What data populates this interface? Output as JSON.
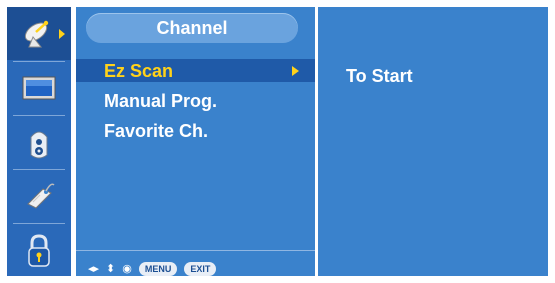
{
  "sidebar": {
    "icons": [
      {
        "name": "satellite-dish-icon",
        "selected": true
      },
      {
        "name": "picture-icon",
        "selected": false
      },
      {
        "name": "audio-info-icon",
        "selected": false
      },
      {
        "name": "tag-icon",
        "selected": false
      },
      {
        "name": "lock-icon",
        "selected": false
      }
    ]
  },
  "menu": {
    "title": "Channel",
    "items": [
      {
        "label": "Ez Scan",
        "active": true
      },
      {
        "label": "Manual Prog.",
        "active": false
      },
      {
        "label": "Favorite Ch.",
        "active": false
      }
    ]
  },
  "submenu": {
    "label": "To Start"
  },
  "hints": {
    "menu_label": "MENU",
    "exit_label": "EXIT",
    "lr_arrows": "◂▸",
    "ud_arrows": "⬍",
    "ok_symbol": "◉"
  },
  "colors": {
    "panel_bg": "#3a82cc",
    "icon_col_bg": "#2a69b9",
    "highlight": "#ffd21a",
    "text": "#ffffff"
  }
}
